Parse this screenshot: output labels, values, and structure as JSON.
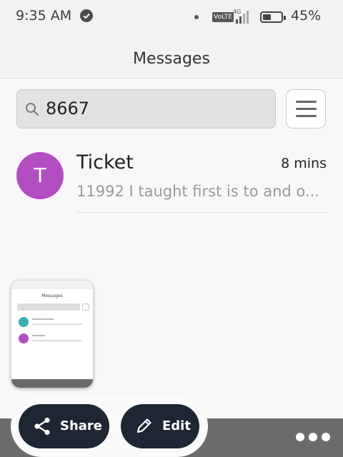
{
  "status_bar": {
    "time": "9:35 AM",
    "volte": "VoLTE",
    "network": "4G",
    "battery_percent": "45%",
    "battery_level": 0.45
  },
  "header": {
    "title": "Messages"
  },
  "search": {
    "value": "8667"
  },
  "conversations": [
    {
      "initial": "T",
      "name": "Ticket",
      "time": "8 mins",
      "preview": "11992 I taught first is to and o...",
      "avatar_color": "#b24ec2"
    }
  ],
  "actions": {
    "share_label": "Share",
    "edit_label": "Edit"
  },
  "colors": {
    "accent_dark": "#1e2533",
    "bottom_bar": "#6b6b6b"
  }
}
